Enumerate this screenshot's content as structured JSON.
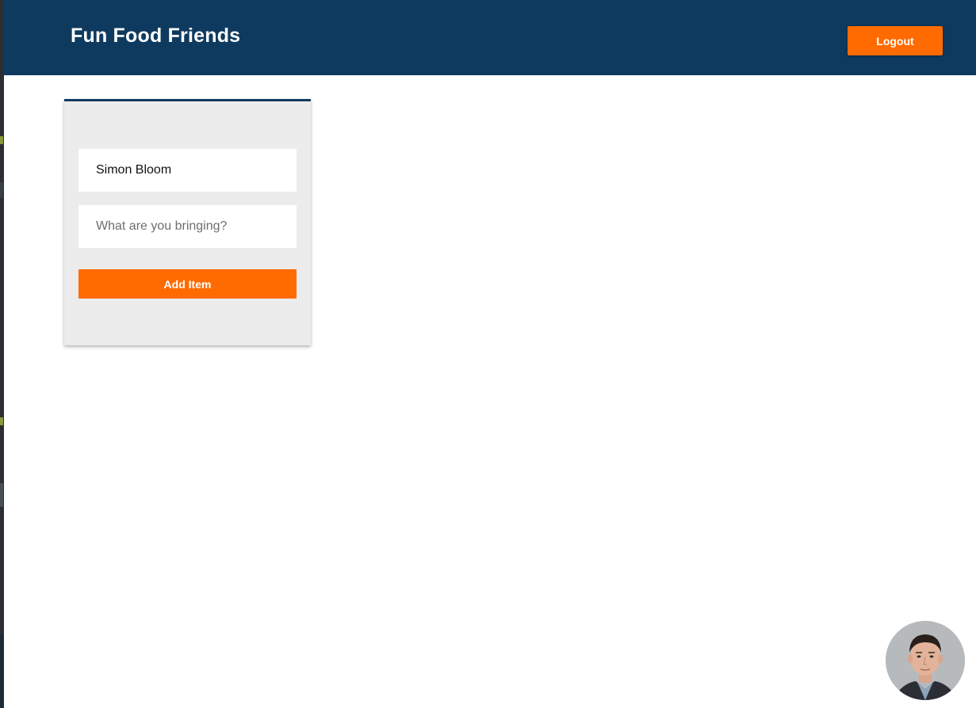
{
  "header": {
    "title": "Fun Food Friends",
    "logout_label": "Logout"
  },
  "form": {
    "name_value": "Simon Bloom",
    "item_placeholder": "What are you bringing?",
    "add_item_label": "Add Item"
  },
  "colors": {
    "header_bg": "#0f3a5f",
    "accent": "#ff6b00",
    "card_bg": "#ececec"
  },
  "icons": {
    "avatar": "user-avatar-photo"
  }
}
